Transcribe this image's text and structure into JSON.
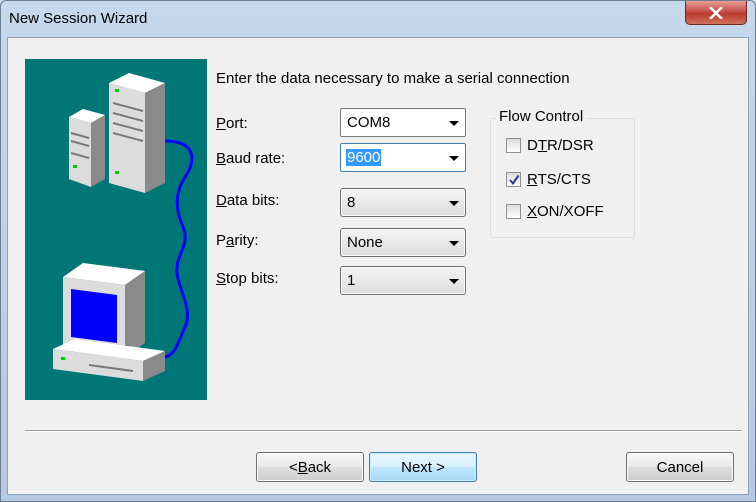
{
  "window": {
    "title": "New Session Wizard"
  },
  "form": {
    "instruction": "Enter the data necessary to make a serial connection",
    "port": {
      "label_accel": "P",
      "label_rest": "ort:",
      "value": "COM8"
    },
    "baud_rate": {
      "label_accel": "B",
      "label_rest": "aud rate:",
      "value": "9600"
    },
    "data_bits": {
      "label_accel": "D",
      "label_rest": "ata bits:",
      "value": "8"
    },
    "parity": {
      "label_pre": "P",
      "label_accel": "a",
      "label_rest": "rity:",
      "value": "None"
    },
    "stop_bits": {
      "label_accel": "S",
      "label_rest": "top bits:",
      "value": "1"
    }
  },
  "flow_control": {
    "title": "Flow Control",
    "options": [
      {
        "pre": "D",
        "accel": "T",
        "rest": "R/DSR",
        "checked": false
      },
      {
        "pre": "",
        "accel": "R",
        "rest": "TS/CTS",
        "checked": true
      },
      {
        "pre": "",
        "accel": "X",
        "rest": "ON/XOFF",
        "checked": false
      }
    ]
  },
  "buttons": {
    "back_prefix": "< ",
    "back_accel": "B",
    "back_rest": "ack",
    "next": "Next >",
    "cancel": "Cancel"
  },
  "icons": {
    "close": "close-icon",
    "illustration": "serial-connection-illustration"
  },
  "colors": {
    "illustration_bg": "#007777",
    "cable": "#0000ff",
    "screen": "#0000ff",
    "selection": "#3399ff",
    "close_button": "#c75050"
  }
}
